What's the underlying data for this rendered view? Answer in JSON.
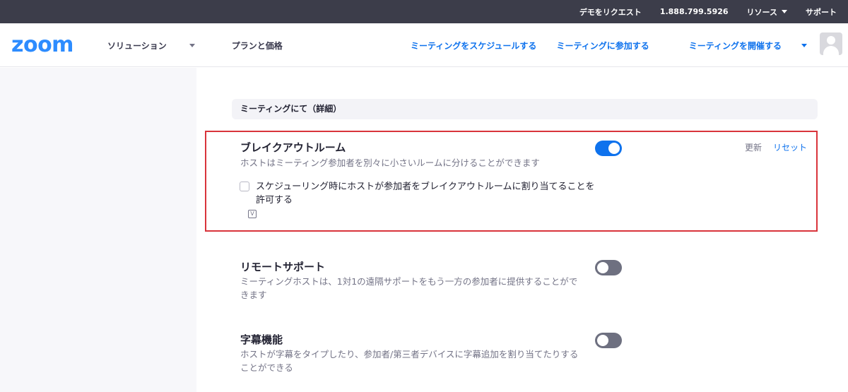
{
  "topbar": {
    "items": [
      {
        "label": "デモをリクエスト"
      },
      {
        "label": "1.888.799.5926"
      },
      {
        "label": "リソース"
      },
      {
        "label": "サポート"
      }
    ]
  },
  "navbar": {
    "logo": "zoom",
    "left_items": [
      {
        "label": "ソリューション"
      },
      {
        "label": "プランと価格"
      }
    ],
    "right_items": [
      {
        "label": "ミーティングをスケジュールする"
      },
      {
        "label": "ミーティングに参加する"
      },
      {
        "label": "ミーティングを開催する"
      }
    ]
  },
  "section": {
    "header": "ミーティングにて（詳細）"
  },
  "settings": [
    {
      "title": "ブレイクアウトルーム",
      "description": "ホストはミーティング参加者を別々に小さいルームに分けることができます",
      "enabled": true,
      "checkbox_label": "スケジューリング時にホストが参加者をブレイクアウトルームに割り当てることを許可する",
      "checkbox_checked": false,
      "badge_icon": "v-badge-icon",
      "badge_text": "V",
      "actions": {
        "update": "更新",
        "reset": "リセット"
      }
    },
    {
      "title": "リモートサポート",
      "description": "ミーティングホストは、1対1の遠隔サポートをもう一方の参加者に提供することができます",
      "enabled": false
    },
    {
      "title": "字幕機能",
      "description": "ホストが字幕をタイプしたり、参加者/第三者デバイスに字幕追加を割り当てたりすることができる",
      "enabled": false
    }
  ],
  "colors": {
    "accent": "#0e72ed",
    "toggle_off": "#6e7080",
    "highlight_border": "#d9343b",
    "topbar_bg": "#3c3d4a"
  }
}
